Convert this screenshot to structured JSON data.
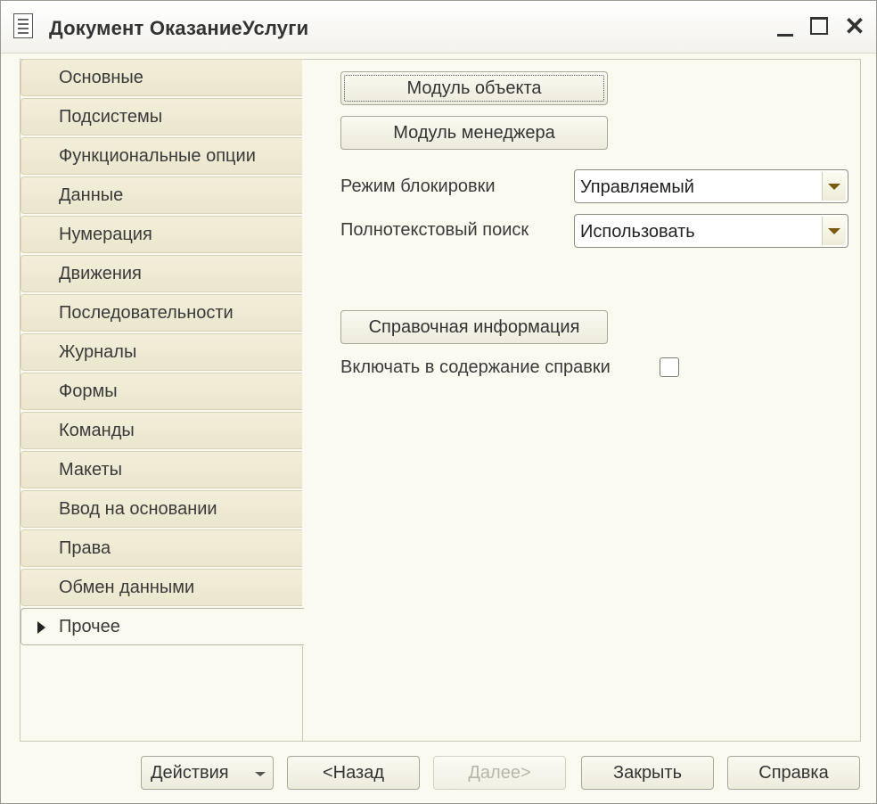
{
  "window": {
    "title": "Документ ОказаниеУслуги"
  },
  "tabs": [
    {
      "label": "Основные"
    },
    {
      "label": "Подсистемы"
    },
    {
      "label": "Функциональные опции"
    },
    {
      "label": "Данные"
    },
    {
      "label": "Нумерация"
    },
    {
      "label": "Движения"
    },
    {
      "label": "Последовательности"
    },
    {
      "label": "Журналы"
    },
    {
      "label": "Формы"
    },
    {
      "label": "Команды"
    },
    {
      "label": "Макеты"
    },
    {
      "label": "Ввод на основании"
    },
    {
      "label": "Права"
    },
    {
      "label": "Обмен данными"
    },
    {
      "label": "Прочее",
      "active": true
    }
  ],
  "main": {
    "object_module_label": "Модуль объекта",
    "manager_module_label": "Модуль менеджера",
    "lock_mode_label": "Режим блокировки",
    "lock_mode_value": "Управляемый",
    "fulltext_search_label": "Полнотекстовый поиск",
    "fulltext_search_value": "Использовать",
    "help_info_label": "Справочная информация",
    "include_in_help_label": "Включать в содержание справки",
    "include_in_help_checked": false
  },
  "footer": {
    "actions_label": "Действия",
    "back_label": "<Назад",
    "next_label": "Далее>",
    "close_label": "Закрыть",
    "help_label": "Справка"
  },
  "icons": {
    "document": "document-icon",
    "minimize": "minimize-icon",
    "maximize": "maximize-icon",
    "close": "close-icon",
    "active_tab_marker": "triangle-right-icon",
    "dropdown": "chevron-down-icon"
  }
}
